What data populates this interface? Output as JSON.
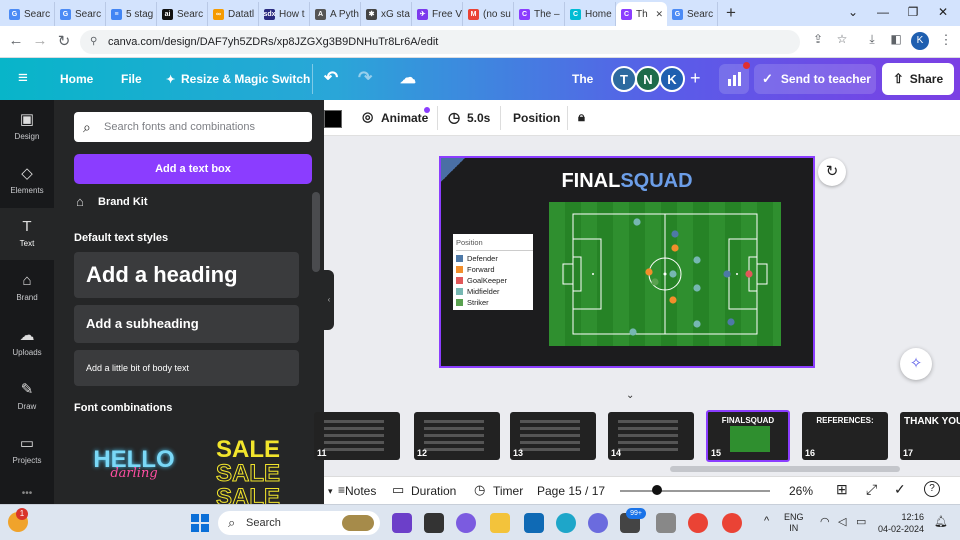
{
  "browser": {
    "tabs": [
      {
        "title": "Searc",
        "color": "#4c8bf5",
        "glyph": "G"
      },
      {
        "title": "Searc",
        "color": "#4c8bf5",
        "glyph": "G"
      },
      {
        "title": "5 stag",
        "color": "#4285f4",
        "glyph": "≡"
      },
      {
        "title": "Searc",
        "color": "#111",
        "glyph": "ai"
      },
      {
        "title": "Datatl",
        "color": "#f59b00",
        "glyph": "∞"
      },
      {
        "title": "How t",
        "color": "#2a2a80",
        "glyph": "sdx"
      },
      {
        "title": "A Pyth",
        "color": "#555",
        "glyph": "A"
      },
      {
        "title": "xG sta",
        "color": "#444",
        "glyph": "✱"
      },
      {
        "title": "Free V",
        "color": "#7c3aed",
        "glyph": "✈"
      },
      {
        "title": "(no su",
        "color": "#ea4335",
        "glyph": "M"
      },
      {
        "title": "The –",
        "color": "#8b3dff",
        "glyph": "C"
      },
      {
        "title": "Home",
        "color": "#00bcd4",
        "glyph": "C"
      },
      {
        "title": "Th",
        "color": "#8b3dff",
        "glyph": "C",
        "active": true
      },
      {
        "title": "Searc",
        "color": "#4c8bf5",
        "glyph": "G"
      }
    ],
    "new_tab": "+",
    "url": "canva.com/design/DAF7yh5ZDRs/xp8JZGXg3B9DNHuTr8Lr6A/edit",
    "profile_initial": "K"
  },
  "canva_header": {
    "menu_icon": "≡",
    "home": "Home",
    "file": "File",
    "resize": "Resize & Magic Switch",
    "design_title": "The",
    "avatars": [
      {
        "initial": "T",
        "color": "#2d6a9f"
      },
      {
        "initial": "N",
        "color": "#1e6b4a"
      },
      {
        "initial": "K",
        "color": "#1f5fb0"
      }
    ],
    "plus": "+",
    "send_to_teacher": "Send to teacher",
    "share": "Share"
  },
  "rail": [
    {
      "label": "Design",
      "icon": "▣"
    },
    {
      "label": "Elements",
      "icon": "◇"
    },
    {
      "label": "Text",
      "icon": "T",
      "active": true
    },
    {
      "label": "Brand",
      "icon": "⌂"
    },
    {
      "label": "Uploads",
      "icon": "☁"
    },
    {
      "label": "Draw",
      "icon": "✎"
    },
    {
      "label": "Projects",
      "icon": "▭"
    }
  ],
  "text_panel": {
    "search_placeholder": "Search fonts and combinations",
    "add_text_box": "Add a text box",
    "brand_kit": "Brand Kit",
    "default_styles": "Default text styles",
    "heading": "Add a heading",
    "subheading": "Add a subheading",
    "body": "Add a little bit of body text",
    "font_combinations": "Font combinations",
    "combo1_line1": "HELLO",
    "combo1_line2": "darling",
    "combo2_line": "SALE"
  },
  "toolbar": {
    "animate": "Animate",
    "duration": "5.0s",
    "position": "Position"
  },
  "slide": {
    "title_part1": "FINAL",
    "title_part2": "SQUAD",
    "legend_title": "Position",
    "legend": [
      {
        "label": "Defender",
        "color": "#4e79a7"
      },
      {
        "label": "Forward",
        "color": "#f28e2b"
      },
      {
        "label": "GoalKeeper",
        "color": "#e15759"
      },
      {
        "label": "Midfielder",
        "color": "#76b7b2"
      },
      {
        "label": "Striker",
        "color": "#59a14f"
      }
    ]
  },
  "filmstrip": {
    "thumbs": [
      {
        "num": "11"
      },
      {
        "num": "12"
      },
      {
        "num": "13"
      },
      {
        "num": "14"
      },
      {
        "num": "15",
        "selected": true,
        "caption": "FINALSQUAD"
      },
      {
        "num": "16",
        "caption": "REFERENCES:"
      },
      {
        "num": "17",
        "caption": "THANK YOU !"
      }
    ]
  },
  "status_bar": {
    "notes": "Notes",
    "duration": "Duration",
    "timer": "Timer",
    "page": "Page 15 / 17",
    "zoom": "26%"
  },
  "taskbar": {
    "search": "Search",
    "lang_line1": "ENG",
    "lang_line2": "IN",
    "time": "12:16",
    "date": "04-02-2024",
    "notif_badge": "1",
    "badge_99": "99+"
  }
}
